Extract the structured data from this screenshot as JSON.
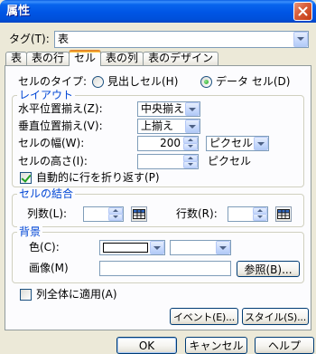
{
  "window": {
    "title": "属性"
  },
  "tag": {
    "label": "タグ(T):",
    "value": "表"
  },
  "tabs": [
    {
      "label": "表",
      "selected": false
    },
    {
      "label": "表の行",
      "selected": false
    },
    {
      "label": "セル",
      "selected": true
    },
    {
      "label": "表の列",
      "selected": false
    },
    {
      "label": "表のデザイン",
      "selected": false
    }
  ],
  "cell_type": {
    "label": "セルのタイプ:",
    "options": [
      {
        "label": "見出しセル(H)",
        "checked": false
      },
      {
        "label": "データ セル(D)",
        "checked": true
      }
    ]
  },
  "layout": {
    "title": "レイアウト",
    "horizontal_align": {
      "label": "水平位置揃え(Z):",
      "value": "中央揃え"
    },
    "vertical_align": {
      "label": "垂直位置揃え(V):",
      "value": "上揃え"
    },
    "width": {
      "label": "セルの幅(W):",
      "value": "200",
      "unit": "ピクセル"
    },
    "height": {
      "label": "セルの高さ(I):",
      "value": "",
      "unit": "ピクセル"
    },
    "wrap_text": {
      "label": "自動的に行を折り返す(P)",
      "checked": true
    }
  },
  "merge": {
    "title": "セルの結合",
    "columns": {
      "label": "列数(L):",
      "value": ""
    },
    "rows": {
      "label": "行数(R):",
      "value": ""
    }
  },
  "background": {
    "title": "背景",
    "color": {
      "label": "色(C):",
      "swatch": "#FFFFFF",
      "name": ""
    },
    "image": {
      "label": "画像(M)",
      "value": ""
    },
    "browse_label": "参照(B)..."
  },
  "apply_to_column": {
    "label": "列全体に適用(A)",
    "checked": false
  },
  "actions": {
    "events_label": "イベント(E)...",
    "style_label": "スタイル(S)..."
  },
  "footer": {
    "ok_label": "OK",
    "cancel_label": "キャンセル",
    "help_label": "ヘルプ"
  },
  "icons": {
    "close": "close-icon",
    "dropdown": "chevron-down-icon",
    "spin_up": "spin-up-icon",
    "spin_down": "spin-down-icon",
    "grid_picker": "grid-icon"
  },
  "colors": {
    "title_bar": "#0054E3",
    "dialog_background": "#ECE9D8",
    "group_title": "#0046D5",
    "selected_tab_accent": "#E68B2C",
    "checkmark": "#21A121"
  }
}
